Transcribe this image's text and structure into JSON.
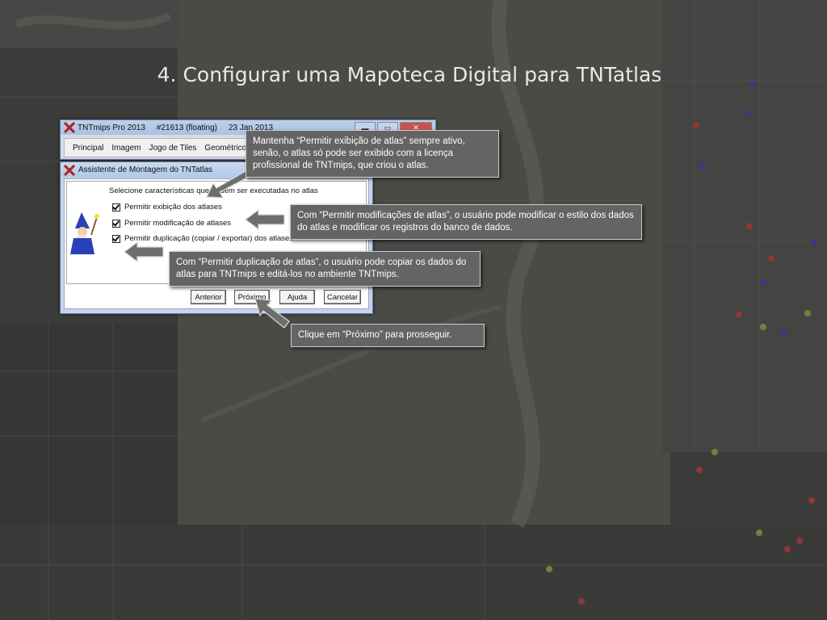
{
  "slide": {
    "title": "4. Configurar uma Mapoteca Digital para TNTatlas"
  },
  "app_window": {
    "title_parts": [
      "TNTmips Pro 2013",
      "#21613 (floating)",
      "23 Jan 2013"
    ],
    "menu": [
      "Principal",
      "Imagem",
      "Jogo de Tiles",
      "Geométrico"
    ],
    "window_controls": {
      "minimize": "▬",
      "maximize": "▭",
      "close": "✕"
    }
  },
  "dialog": {
    "title": "Assistente de Montagem do TNTatlas",
    "subtitle": "Selecione características que podem ser executadas no atlas",
    "options": [
      {
        "label": "Permitir exibição dos atlases",
        "checked": true
      },
      {
        "label": "Permitir modificação de atlases",
        "checked": true
      },
      {
        "label": "Permitir duplicação (copiar / exportar) dos atlases",
        "checked": true
      }
    ],
    "buttons": {
      "back": "Anterior",
      "next": "Próximo",
      "help": "Ajuda",
      "cancel": "Cancelar"
    }
  },
  "callouts": {
    "exibicao": "Mantenha “Permitir exibição de atlas” sempre ativo, senão, o atlas só pode ser exibido com a licença profissional de TNTmips, que criou o atlas.",
    "modificacao": "Com “Permitir modificações de atlas”, o usuário pode modificar o estilo dos dados do atlas e modificar os registros do banco de dados.",
    "duplicacao": "Com “Permitir duplicação de atlas”, o usuário pode copiar os dados do atlas para TNTmips e editá-los no ambiente TNTmips.",
    "proximo": "Clique em “Próximo” para prosseguir."
  },
  "colors": {
    "callout_bg": "#646464",
    "arrow_fill": "#6e6e6e",
    "background": "#3d3d3b"
  }
}
